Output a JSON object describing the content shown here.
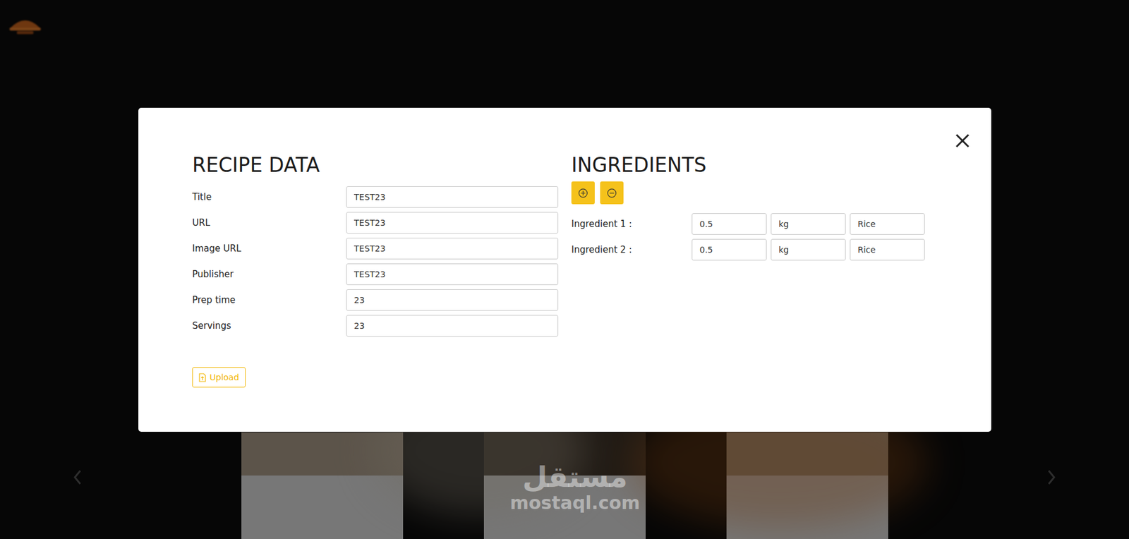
{
  "recipe_data": {
    "heading": "RECIPE DATA",
    "fields": [
      {
        "label": "Title",
        "value": "TEST23"
      },
      {
        "label": "URL",
        "value": "TEST23"
      },
      {
        "label": "Image URL",
        "value": "TEST23"
      },
      {
        "label": "Publisher",
        "value": "TEST23"
      },
      {
        "label": "Prep time",
        "value": "23"
      },
      {
        "label": "Servings",
        "value": "23"
      }
    ],
    "upload_button": "Upload"
  },
  "ingredients": {
    "heading": "INGREDIENTS",
    "rows": [
      {
        "label": "Ingredient 1 :",
        "quantity": "0.5",
        "unit": "kg",
        "description": "Rice"
      },
      {
        "label": "Ingredient 2 :",
        "quantity": "0.5",
        "unit": "kg",
        "description": "Rice"
      }
    ]
  },
  "watermark": {
    "arabic": "مستقل",
    "latin": "mostaql.com"
  }
}
